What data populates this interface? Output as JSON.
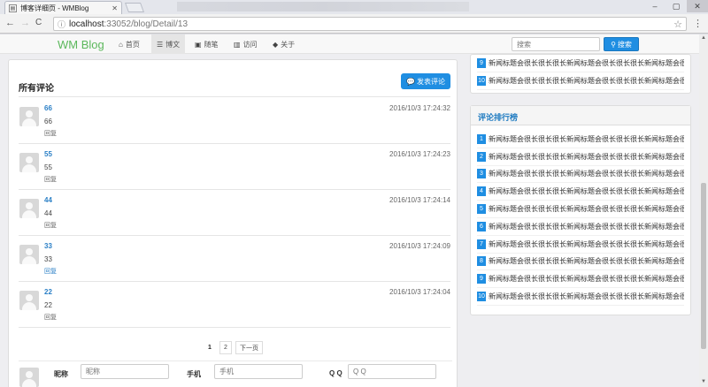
{
  "browser": {
    "tab_title": "博客详细页 - WMBlog",
    "tab_favicon": "page-icon",
    "url_host": "localhost",
    "url_path": ":33052/blog/Detail/13",
    "nav_back": "←",
    "nav_forward": "→",
    "nav_reload": "C"
  },
  "navbar": {
    "brand": "WM Blog",
    "items": [
      {
        "label": "首页",
        "icon": "home-icon",
        "glyph": "⌂"
      },
      {
        "label": "博文",
        "icon": "list-icon",
        "glyph": "☰"
      },
      {
        "label": "随笔",
        "icon": "film-icon",
        "glyph": "▣"
      },
      {
        "label": "访问",
        "icon": "bar-chart-icon",
        "glyph": "▥"
      },
      {
        "label": "关于",
        "icon": "tag-icon",
        "glyph": "◆"
      }
    ],
    "active_index": 1,
    "search_placeholder": "搜索",
    "search_button": "搜索"
  },
  "comments_panel": {
    "title": "所有评论",
    "post_button": "发表评论",
    "comments": [
      {
        "name": "66",
        "body": "66",
        "time": "2016/10/3 17:24:32",
        "reply": "回复"
      },
      {
        "name": "55",
        "body": "55",
        "time": "2016/10/3 17:24:23",
        "reply": "回复"
      },
      {
        "name": "44",
        "body": "44",
        "time": "2016/10/3 17:24:14",
        "reply": "回复"
      },
      {
        "name": "33",
        "body": "33",
        "time": "2016/10/3 17:24:09",
        "reply": "回复"
      },
      {
        "name": "22",
        "body": "22",
        "time": "2016/10/3 17:24:04",
        "reply": "回复"
      }
    ],
    "pager": {
      "pages": [
        "1",
        "2"
      ],
      "current": "1",
      "next": "下一页"
    },
    "form": {
      "name_label": "昵称",
      "name_placeholder": "昵称",
      "phone_label": "手机",
      "phone_placeholder": "手机",
      "qq_label": "Q Q",
      "qq_placeholder": "Q Q"
    }
  },
  "top_list": {
    "items": [
      {
        "num": "9",
        "text": "新闻标题会很长很长很长新闻标题会很长很长很长新闻标题会很长"
      },
      {
        "num": "10",
        "text": "新闻标题会很长很长很长新闻标题会很长很长很长新闻标题会很长"
      }
    ]
  },
  "ranking": {
    "title": "评论排行榜",
    "items": [
      {
        "num": "1",
        "text": "新闻标题会很长很长很长新闻标题会很长很长很长新闻标题会很长"
      },
      {
        "num": "2",
        "text": "新闻标题会很长很长很长新闻标题会很长很长很长新闻标题会很长"
      },
      {
        "num": "3",
        "text": "新闻标题会很长很长很长新闻标题会很长很长很长新闻标题会很长"
      },
      {
        "num": "4",
        "text": "新闻标题会很长很长很长新闻标题会很长很长很长新闻标题会很长"
      },
      {
        "num": "5",
        "text": "新闻标题会很长很长很长新闻标题会很长很长很长新闻标题会很长"
      },
      {
        "num": "6",
        "text": "新闻标题会很长很长很长新闻标题会很长很长很长新闻标题会很长"
      },
      {
        "num": "7",
        "text": "新闻标题会很长很长很长新闻标题会很长很长很长新闻标题会很长"
      },
      {
        "num": "8",
        "text": "新闻标题会很长很长很长新闻标题会很长很长很长新闻标题会很长"
      },
      {
        "num": "9",
        "text": "新闻标题会很长很长很长新闻标题会很长很长很长新闻标题会很长"
      },
      {
        "num": "10",
        "text": "新闻标题会很长很长很长新闻标题会很长很长很长新闻标题会很长"
      }
    ]
  },
  "colors": {
    "accent": "#1f8ee2",
    "brand": "#5cb85c",
    "link": "#2a7fc6"
  }
}
